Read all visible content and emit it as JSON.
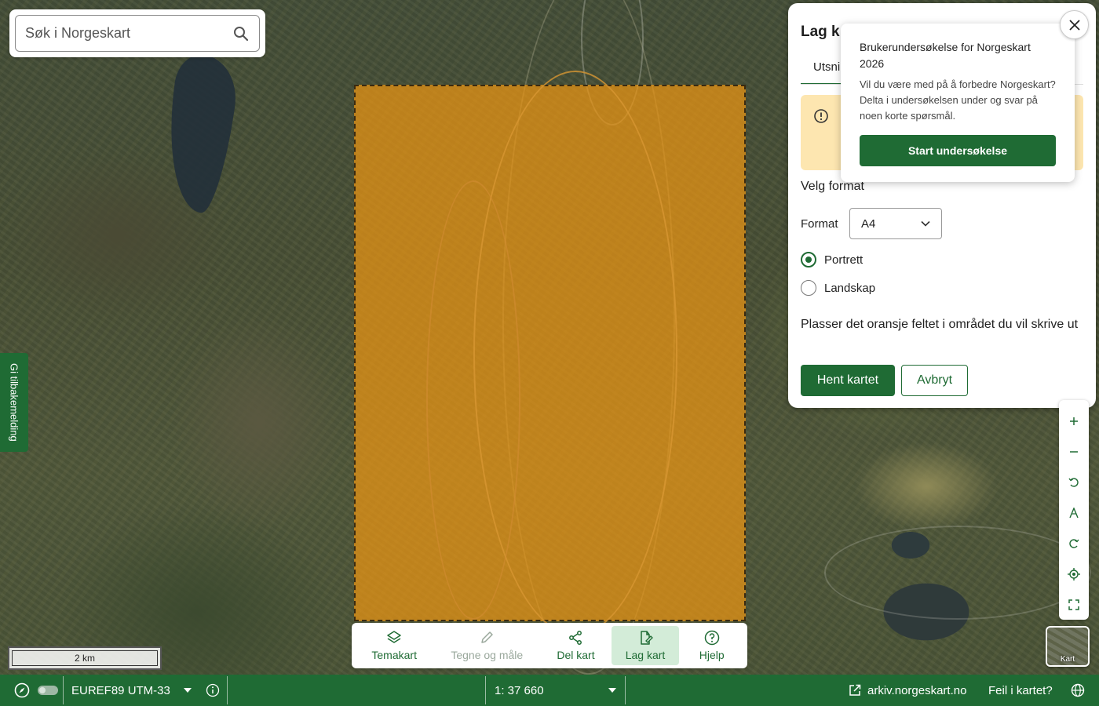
{
  "search": {
    "placeholder": "Søk i Norgeskart"
  },
  "feedback": {
    "label": "Gi tilbakemelding"
  },
  "panel": {
    "title": "Lag k",
    "tab_label": "Utsni",
    "warning_text": "I",
    "velg_format": "Velg format",
    "format_label": "Format",
    "format_value": "A4",
    "orientation_options": [
      {
        "label": "Portrett",
        "selected": true
      },
      {
        "label": "Landskap",
        "selected": false
      }
    ],
    "instruction": "Plasser det oransje feltet i området du vil skrive ut",
    "primary_button": "Hent kartet",
    "secondary_button": "Avbryt"
  },
  "survey": {
    "title": "Brukerundersøkelse for Norgeskart 2026",
    "body": "Vil du være med på å forbedre Norgeskart? Delta i undersøkelsen under og svar på noen korte spørsmål.",
    "button": "Start undersøkelse"
  },
  "map_controls": [
    "zoom-in-icon",
    "zoom-out-icon",
    "rotate-left-icon",
    "north-arrow-icon",
    "rotate-right-icon",
    "my-location-icon",
    "fullscreen-icon"
  ],
  "basemap": {
    "label": "Kart"
  },
  "scale": {
    "label": "2 km"
  },
  "toolbar": {
    "items": [
      {
        "label": "Temakart",
        "icon": "layers-icon",
        "state": "normal"
      },
      {
        "label": "Tegne og måle",
        "icon": "pencil-icon",
        "state": "disabled"
      },
      {
        "label": "Del kart",
        "icon": "share-icon",
        "state": "normal"
      },
      {
        "label": "Lag kart",
        "icon": "export-map-icon",
        "state": "active"
      },
      {
        "label": "Hjelp",
        "icon": "help-icon",
        "state": "normal"
      }
    ]
  },
  "statusbar": {
    "projection": "EUREF89 UTM-33",
    "scale": "1: 37 660",
    "archive_link": "arkiv.norgeskart.no",
    "error_link": "Feil i kartet?"
  },
  "colors": {
    "brand_green": "#1f6b34",
    "print_area": "#eb9614",
    "warning_bg": "#fde6b0"
  }
}
